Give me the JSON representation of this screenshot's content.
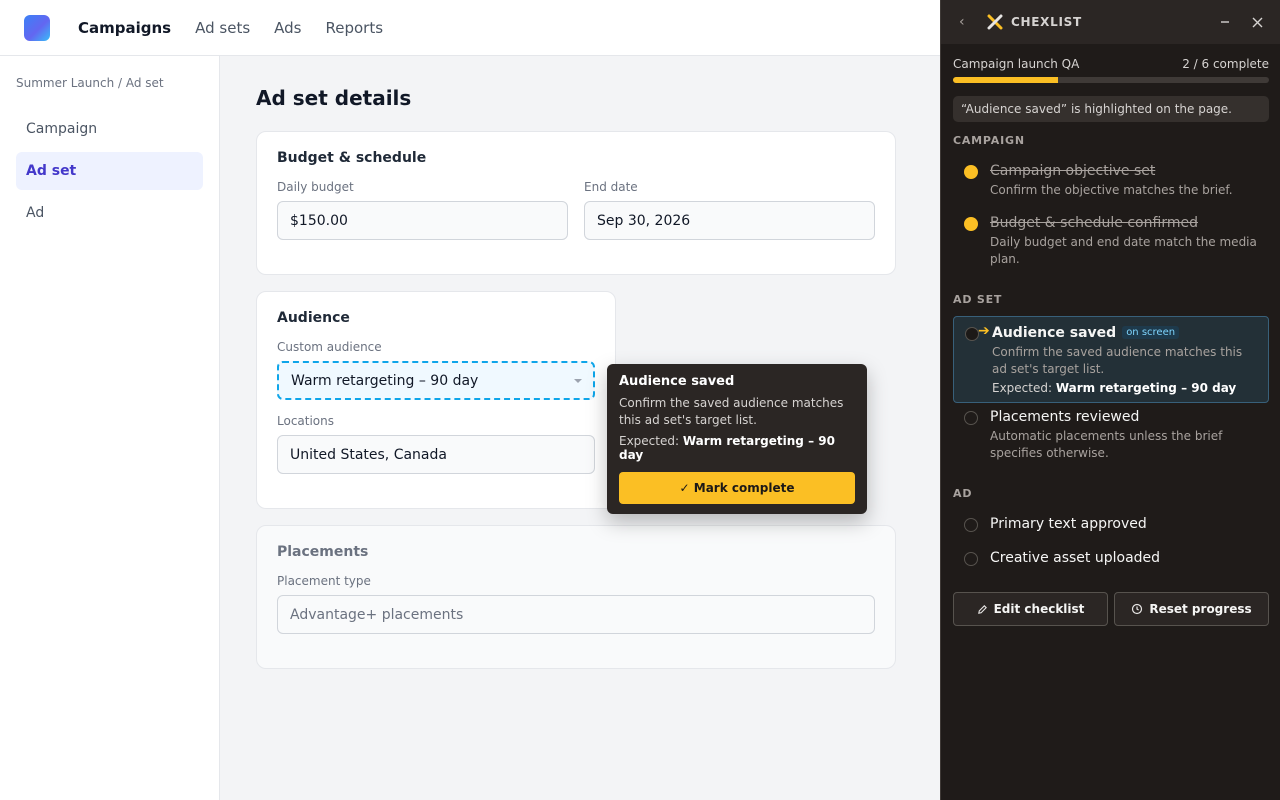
{
  "topnav": {
    "items": [
      {
        "label": "Campaigns",
        "active": true
      },
      {
        "label": "Ad sets"
      },
      {
        "label": "Ads"
      },
      {
        "label": "Reports"
      }
    ]
  },
  "sidebar": {
    "breadcrumb": "Summer Launch / Ad set",
    "items": [
      {
        "label": "Campaign"
      },
      {
        "label": "Ad set",
        "active": true
      },
      {
        "label": "Ad"
      }
    ]
  },
  "main": {
    "title": "Ad set details",
    "budget": {
      "title": "Budget & schedule",
      "daily_label": "Daily budget",
      "daily_value": "$150.00",
      "end_label": "End date",
      "end_value": "Sep 30, 2026"
    },
    "audience": {
      "title": "Audience",
      "custom_label": "Custom audience",
      "custom_value": "Warm retargeting – 90 day",
      "locations_label": "Locations",
      "locations_value": "United States, Canada"
    },
    "placements": {
      "title": "Placements",
      "type_label": "Placement type",
      "type_value": "Advantage+ placements"
    }
  },
  "tooltip": {
    "title": "Audience saved",
    "description": "Confirm the saved audience matches this ad set's target list.",
    "expected_prefix": "Expected:",
    "expected_value": "Warm retargeting – 90 day",
    "button": "✓ Mark complete"
  },
  "checklist": {
    "brand": "CHEXLIST",
    "progress_title": "Campaign launch QA",
    "progress_text": "2 / 6 complete",
    "progress_fraction": 0.333,
    "notice": "“Audience saved” is highlighted on the page.",
    "accent": "#fbbf24",
    "sections": {
      "campaign": "CAMPAIGN",
      "adset": "AD SET",
      "ad": "AD"
    },
    "tasks": {
      "objective": {
        "title": "Campaign objective set",
        "desc": "Confirm the objective matches the brief."
      },
      "budget": {
        "title": "Budget & schedule confirmed",
        "desc": "Daily budget and end date match the media plan."
      },
      "audience": {
        "title": "Audience saved",
        "badge": "on screen",
        "desc": "Confirm the saved audience matches this ad set's target list.",
        "expected_prefix": "Expected:",
        "expected_value": "Warm retargeting – 90 day"
      },
      "placements": {
        "title": "Placements reviewed",
        "desc": "Automatic placements unless the brief specifies otherwise."
      },
      "primary_text": {
        "title": "Primary text approved"
      },
      "creative": {
        "title": "Creative asset uploaded"
      }
    },
    "edit_button": "Edit checklist",
    "reset_button": "Reset progress"
  }
}
